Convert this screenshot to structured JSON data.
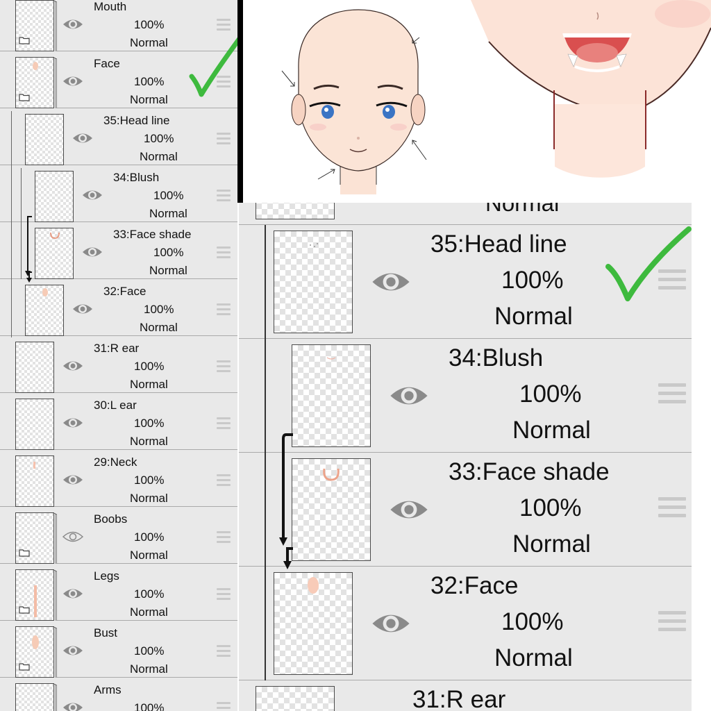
{
  "left_panel": {
    "layers": [
      {
        "name": "Mouth",
        "opacity": "100%",
        "blend": "Normal",
        "type": "folder",
        "eye": "visible"
      },
      {
        "name": "Face",
        "opacity": "100%",
        "blend": "Normal",
        "type": "folder",
        "eye": "visible"
      },
      {
        "name": "35:Head line",
        "opacity": "100%",
        "blend": "Normal",
        "type": "layer",
        "eye": "visible"
      },
      {
        "name": "34:Blush",
        "opacity": "100%",
        "blend": "Normal",
        "type": "layer",
        "eye": "visible"
      },
      {
        "name": "33:Face shade",
        "opacity": "100%",
        "blend": "Normal",
        "type": "layer",
        "eye": "visible"
      },
      {
        "name": "32:Face",
        "opacity": "100%",
        "blend": "Normal",
        "type": "layer",
        "eye": "visible"
      },
      {
        "name": "31:R ear",
        "opacity": "100%",
        "blend": "Normal",
        "type": "layer",
        "eye": "visible"
      },
      {
        "name": "30:L ear",
        "opacity": "100%",
        "blend": "Normal",
        "type": "layer",
        "eye": "visible"
      },
      {
        "name": "29:Neck",
        "opacity": "100%",
        "blend": "Normal",
        "type": "layer",
        "eye": "visible"
      },
      {
        "name": "Boobs",
        "opacity": "100%",
        "blend": "Normal",
        "type": "folder",
        "eye": "hidden"
      },
      {
        "name": "Legs",
        "opacity": "100%",
        "blend": "Normal",
        "type": "folder",
        "eye": "visible"
      },
      {
        "name": "Bust",
        "opacity": "100%",
        "blend": "Normal",
        "type": "folder",
        "eye": "visible"
      },
      {
        "name": "Arms",
        "opacity": "100%",
        "blend": "Normal",
        "type": "folder",
        "eye": "visible"
      }
    ]
  },
  "right_panel": {
    "top_partial": {
      "blend": "Normal"
    },
    "layers": [
      {
        "name": "35:Head line",
        "opacity": "100%",
        "blend": "Normal"
      },
      {
        "name": "34:Blush",
        "opacity": "100%",
        "blend": "Normal"
      },
      {
        "name": "33:Face shade",
        "opacity": "100%",
        "blend": "Normal"
      },
      {
        "name": "32:Face",
        "opacity": "100%",
        "blend": "Normal"
      }
    ],
    "bottom_partial": {
      "name": "31:R ear"
    }
  },
  "colors": {
    "panel_bg": "#e9e9e9",
    "checkmark": "#2bb52b",
    "eye": "#8a8a8a",
    "skin": "#fbe3d5",
    "iris": "#3a74c4"
  },
  "icons": [
    "eye-icon",
    "folder-icon",
    "drag-handle-icon",
    "check-icon",
    "clip-arrow-icon"
  ]
}
